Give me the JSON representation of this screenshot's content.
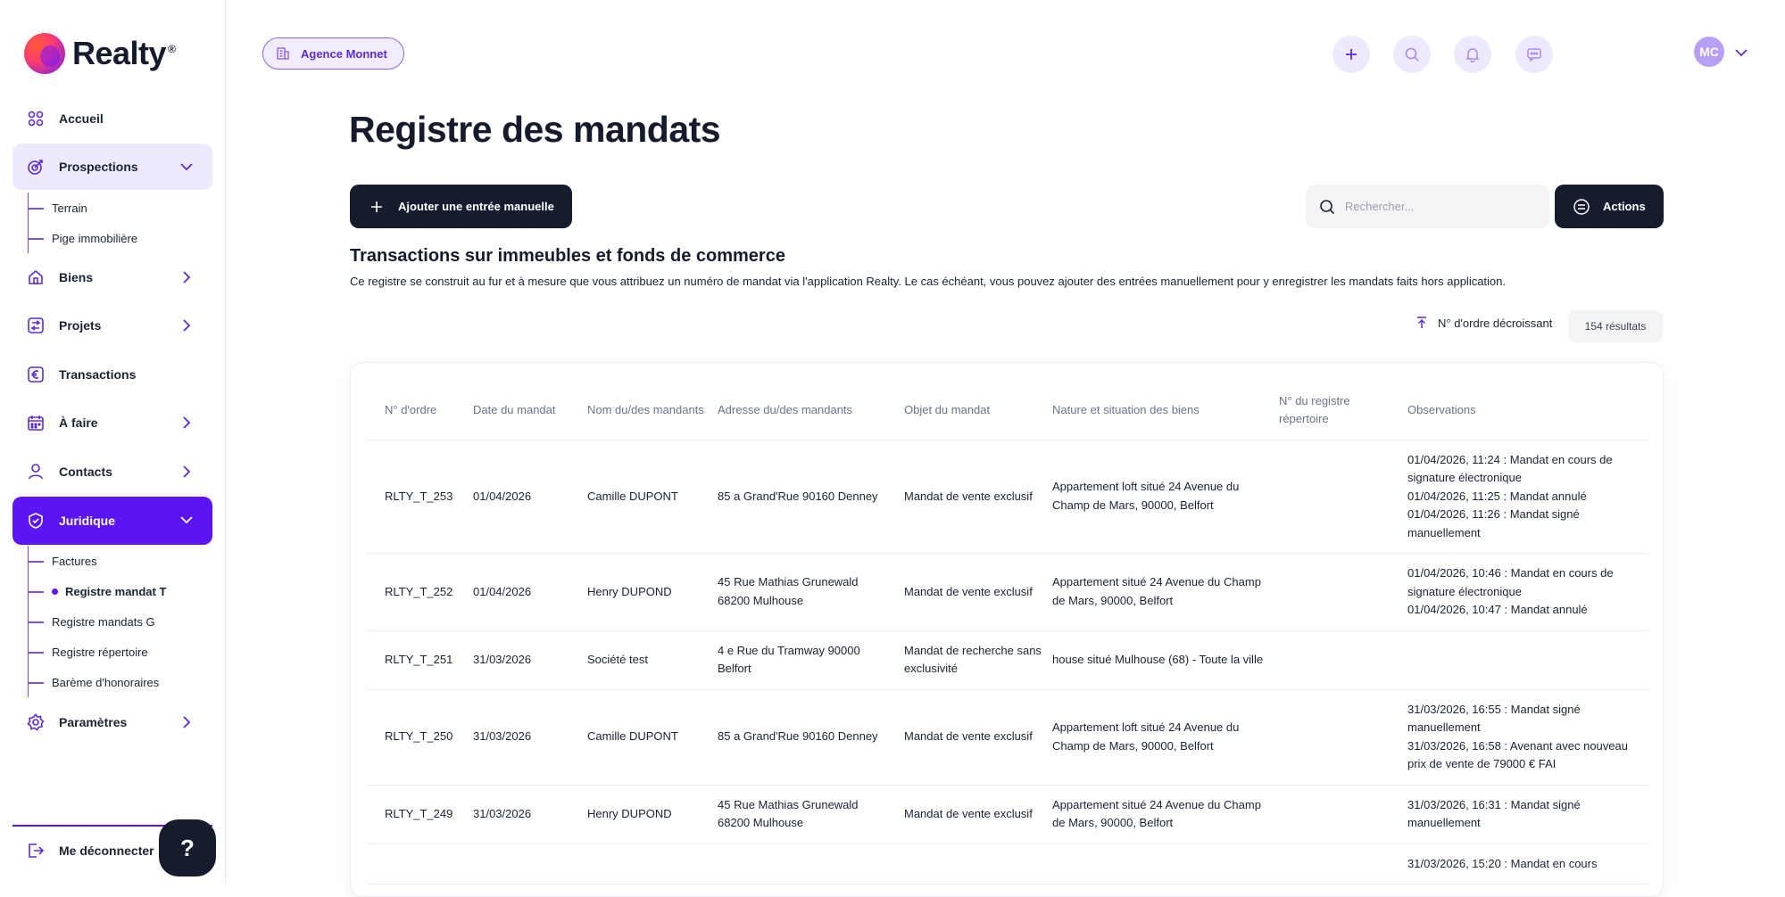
{
  "brand": {
    "name": "Realty",
    "reg": "®"
  },
  "sidebar": {
    "items": [
      {
        "label": "Accueil",
        "icon": "grid-icon"
      },
      {
        "label": "Prospections",
        "icon": "target-icon",
        "open": true,
        "children": [
          "Terrain",
          "Pige immobilière"
        ]
      },
      {
        "label": "Biens",
        "icon": "house-icon"
      },
      {
        "label": "Projets",
        "icon": "transfer-icon"
      },
      {
        "label": "Transactions",
        "icon": "euro-icon"
      },
      {
        "label": "À faire",
        "icon": "calendar-icon"
      },
      {
        "label": "Contacts",
        "icon": "user-icon"
      },
      {
        "label": "Juridique",
        "icon": "shield-icon",
        "active": true,
        "children": [
          "Factures",
          "Registre mandat T",
          "Registre mandats G",
          "Registre répertoire",
          "Barème d'honoraires"
        ]
      },
      {
        "label": "Paramètres",
        "icon": "gear-icon"
      }
    ],
    "logout_label": "Me déconnecter",
    "help_label": "?"
  },
  "header": {
    "agency_label": "Agence Monnet",
    "avatar_initials": "MC"
  },
  "main": {
    "title": "Registre des mandats",
    "add_button_label": "Ajouter une entrée manuelle",
    "search_placeholder": "Rechercher...",
    "actions_label": "Actions",
    "section_title": "Transactions sur immeubles et fonds de commerce",
    "section_desc": "Ce registre se construit au fur et à mesure que vous attribuez un numéro de mandat via l'application Realty. Le cas échéant, vous pouvez ajouter des entrées manuellement pour y enregistrer les mandats faits hors application.",
    "sort_label": "N° d'ordre décroissant",
    "result_count": "154 résultats"
  },
  "table": {
    "columns": [
      "N° d'ordre",
      "Date du mandat",
      "Nom du/des mandants",
      "Adresse du/des mandants",
      "Objet du mandat",
      "Nature et situation des biens",
      "N° du registre répertoire",
      "Observations"
    ],
    "rows": [
      {
        "order": "RLTY_T_253",
        "date": "01/04/2026",
        "name": "Camille DUPONT",
        "address": "85 a Grand'Rue 90160 Denney",
        "object": "Mandat de vente exclusif",
        "nature": "Appartement loft situé 24 Avenue du Champ de Mars, 90000, Belfort",
        "registry": "",
        "obs": [
          "01/04/2026, 11:24 : Mandat en cours de signature électronique",
          "01/04/2026, 11:25 : Mandat annulé",
          "01/04/2026, 11:26 : Mandat signé manuellement"
        ]
      },
      {
        "order": "RLTY_T_252",
        "date": "01/04/2026",
        "name": "Henry DUPOND",
        "address": "45 Rue Mathias Grunewald 68200 Mulhouse",
        "object": "Mandat de vente exclusif",
        "nature": "Appartement situé 24 Avenue du Champ de Mars, 90000, Belfort",
        "registry": "",
        "obs": [
          "01/04/2026, 10:46 : Mandat en cours de signature électronique",
          "01/04/2026, 10:47 : Mandat annulé"
        ]
      },
      {
        "order": "RLTY_T_251",
        "date": "31/03/2026",
        "name": "Société test",
        "address": "4 e Rue du Tramway 90000 Belfort",
        "object": "Mandat de recherche sans exclusivité",
        "nature": "house situé Mulhouse (68) - Toute la ville",
        "registry": "",
        "obs": []
      },
      {
        "order": "RLTY_T_250",
        "date": "31/03/2026",
        "name": "Camille DUPONT",
        "address": "85 a Grand'Rue 90160 Denney",
        "object": "Mandat de vente exclusif",
        "nature": "Appartement loft situé 24 Avenue du Champ de Mars, 90000, Belfort",
        "registry": "",
        "obs": [
          "31/03/2026, 16:55 : Mandat signé manuellement",
          "31/03/2026, 16:58 : Avenant avec nouveau prix de vente de 79000 € FAI"
        ]
      },
      {
        "order": "RLTY_T_249",
        "date": "31/03/2026",
        "name": "Henry DUPOND",
        "address": "45 Rue Mathias Grunewald 68200 Mulhouse",
        "object": "Mandat de vente exclusif",
        "nature": "Appartement situé 24 Avenue du Champ de Mars, 90000, Belfort",
        "registry": "",
        "obs": [
          "31/03/2026, 16:31 : Mandat signé manuellement"
        ]
      },
      {
        "order": "",
        "date": "",
        "name": "",
        "address": "",
        "object": "",
        "nature": "",
        "registry": "",
        "obs": [
          "31/03/2026, 15:20 : Mandat en cours"
        ]
      }
    ]
  },
  "colors": {
    "accent": "#5a15f2",
    "dark": "#141c2e",
    "accent_light": "#efe9ff"
  }
}
